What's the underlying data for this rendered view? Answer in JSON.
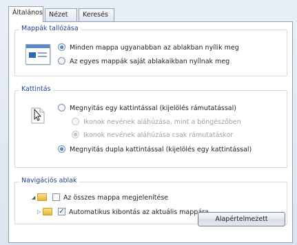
{
  "tabs": [
    {
      "label": "Általános",
      "active": true
    },
    {
      "label": "Nézet",
      "active": false
    },
    {
      "label": "Keresés",
      "active": false
    }
  ],
  "browse_folders": {
    "title": "Mappák tallózása",
    "options": [
      {
        "label": "Minden mappa ugyanabban az ablakban nyílik meg",
        "selected": true
      },
      {
        "label": "Az egyes mappák saját ablakaikban nyílnak meg",
        "selected": false
      }
    ]
  },
  "click_items": {
    "title": "Kattintás",
    "options": [
      {
        "label": "Megnyitás egy kattintással (kijelölés rámutatással)",
        "selected": false,
        "enabled": true
      },
      {
        "label": "Ikonok nevének aláhúzása, mint a böngészőben",
        "selected": false,
        "enabled": false
      },
      {
        "label": "Ikonok nevének aláhúzása csak rámutatáskor",
        "selected": true,
        "enabled": false
      },
      {
        "label": "Megnyitás dupla kattintással (kijelölés egy kattintással)",
        "selected": true,
        "enabled": true
      }
    ]
  },
  "navigation_pane": {
    "title": "Navigációs ablak",
    "options": [
      {
        "label": "Az összes mappa megjelenítése",
        "checked": false
      },
      {
        "label": "Automatikus kibontás az aktuális mappára",
        "checked": true
      }
    ]
  },
  "restore_button": "Alapértelmezett"
}
